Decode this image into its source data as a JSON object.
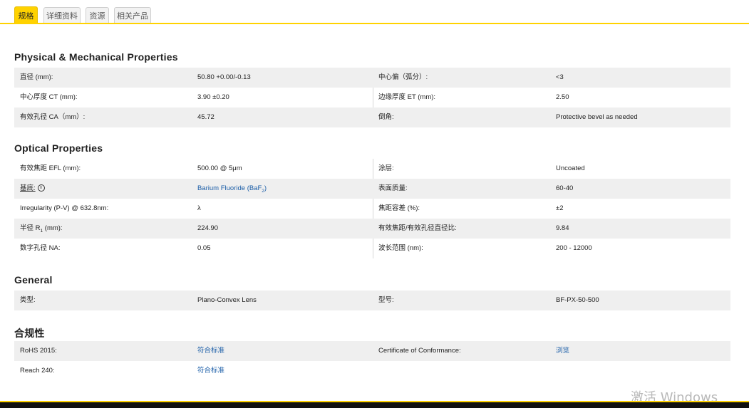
{
  "tabs": [
    "规格",
    "详细资料",
    "资源",
    "相关产品"
  ],
  "sections": {
    "physical": {
      "title": "Physical & Mechanical Properties",
      "rows": [
        {
          "l1": "直径 (mm):",
          "v1": "50.80 +0.00/-0.13",
          "l2": "中心偏（弧分）:",
          "v2": "<3"
        },
        {
          "l1": "中心厚度 CT (mm):",
          "v1": "3.90 ±0.20",
          "l2": "边缘厚度 ET (mm):",
          "v2": "2.50"
        },
        {
          "l1": "有效孔径 CA（mm）:",
          "v1": "45.72",
          "l2": "倒角:",
          "v2": "Protective bevel as needed"
        }
      ]
    },
    "optical": {
      "title": "Optical Properties",
      "rows": [
        {
          "l1": "有效焦距 EFL (mm):",
          "v1": "500.00 @ 5μm",
          "l2": "涂层:",
          "v2": "Uncoated"
        },
        {
          "l1": "基底:",
          "v1": "Barium Fluoride (BaF",
          "v1_sub": "2",
          "v1_end": ")",
          "l2": "表面质量:",
          "v2": "60-40"
        },
        {
          "l1": "Irregularity (P-V) @ 632.8nm:",
          "v1": "λ",
          "l2": "焦距容差 (%):",
          "v2": "±2"
        },
        {
          "l1": "半径 R",
          "l1_sub": "1",
          "l1_end": " (mm):",
          "v1": "224.90",
          "l2": "有效焦距/有效孔径直径比:",
          "v2": "9.84"
        },
        {
          "l1": "数字孔径 NA:",
          "v1": "0.05",
          "l2": "波长范围 (nm):",
          "v2": "200 - 12000"
        }
      ]
    },
    "general": {
      "title": "General",
      "rows": [
        {
          "l1": "类型:",
          "v1": "Plano-Convex Lens",
          "l2": "型号:",
          "v2": "BF-PX-50-500"
        }
      ]
    },
    "compliance": {
      "title": "合规性",
      "rows": [
        {
          "l1": "RoHS 2015:",
          "v1": "符合标准",
          "l2": "Certificate of Conformance:",
          "v2": "浏览"
        },
        {
          "l1": "Reach 240:",
          "v1": "符合标准"
        }
      ]
    }
  },
  "info_icon": "i",
  "watermark": "激活 Windows",
  "colors": {
    "accent": "#ffd200",
    "link": "#1d5fa8",
    "row_shade": "#efefef"
  }
}
